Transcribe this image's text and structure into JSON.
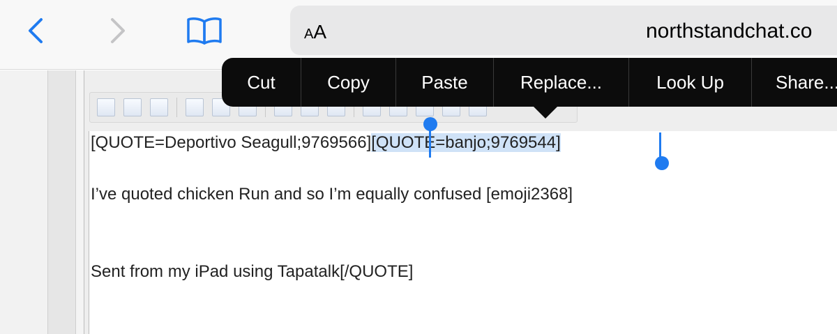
{
  "browser": {
    "back_icon": "chevron-left-icon",
    "forward_icon": "chevron-right-icon",
    "bookmarks_icon": "book-icon",
    "reader_label_small": "A",
    "reader_label_large": "A",
    "url": "northstandchat.co",
    "accent_color": "#1f7bf0"
  },
  "context_menu": {
    "items": [
      "Cut",
      "Copy",
      "Paste",
      "Replace...",
      "Look Up",
      "Share..."
    ]
  },
  "editor": {
    "line1_prefix": "[QUOTE=Deportivo Seagull;9769566]",
    "line1_selected": "[QUOTE=banjo;9769544]",
    "line2": "I’ve quoted chicken Run and so I’m equally confused [emoji2368]",
    "line3": "Sent from my iPad using Tapatalk[/QUOTE]",
    "selection_color": "#cfe2f7"
  }
}
